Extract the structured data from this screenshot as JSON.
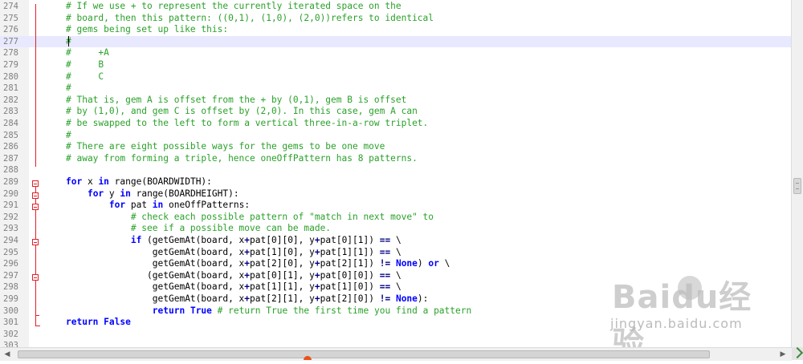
{
  "editor": {
    "current_line": 277,
    "lines": [
      {
        "n": "274",
        "indent": "",
        "parts": [
          {
            "t": "c",
            "v": "# If we use + to represent the currently iterated space on the"
          }
        ]
      },
      {
        "n": "275",
        "indent": "",
        "parts": [
          {
            "t": "c",
            "v": "# board, then this pattern: ((0,1), (1,0), (2,0))refers to identical"
          }
        ]
      },
      {
        "n": "276",
        "indent": "",
        "parts": [
          {
            "t": "c",
            "v": "# gems being set up like this:"
          }
        ]
      },
      {
        "n": "277",
        "indent": "",
        "parts": [
          {
            "t": "c",
            "v": "#"
          }
        ]
      },
      {
        "n": "278",
        "indent": "",
        "parts": [
          {
            "t": "c",
            "v": "#     +A"
          }
        ]
      },
      {
        "n": "279",
        "indent": "",
        "parts": [
          {
            "t": "c",
            "v": "#     B"
          }
        ]
      },
      {
        "n": "280",
        "indent": "",
        "parts": [
          {
            "t": "c",
            "v": "#     C"
          }
        ]
      },
      {
        "n": "281",
        "indent": "",
        "parts": [
          {
            "t": "c",
            "v": "#"
          }
        ]
      },
      {
        "n": "282",
        "indent": "",
        "parts": [
          {
            "t": "c",
            "v": "# That is, gem A is offset from the + by (0,1), gem B is offset"
          }
        ]
      },
      {
        "n": "283",
        "indent": "",
        "parts": [
          {
            "t": "c",
            "v": "# by (1,0), and gem C is offset by (2,0). In this case, gem A can"
          }
        ]
      },
      {
        "n": "284",
        "indent": "",
        "parts": [
          {
            "t": "c",
            "v": "# be swapped to the left to form a vertical three-in-a-row triplet."
          }
        ]
      },
      {
        "n": "285",
        "indent": "",
        "parts": [
          {
            "t": "c",
            "v": "#"
          }
        ]
      },
      {
        "n": "286",
        "indent": "",
        "parts": [
          {
            "t": "c",
            "v": "# There are eight possible ways for the gems to be one move"
          }
        ]
      },
      {
        "n": "287",
        "indent": "",
        "parts": [
          {
            "t": "c",
            "v": "# away from forming a triple, hence oneOffPattern has 8 patterns."
          }
        ]
      },
      {
        "n": "288",
        "indent": "",
        "parts": []
      },
      {
        "n": "289",
        "indent": "",
        "parts": [
          {
            "t": "k",
            "v": "for"
          },
          {
            "t": "nm",
            "v": " x "
          },
          {
            "t": "k",
            "v": "in"
          },
          {
            "t": "nm",
            "v": " range(BOARDWIDTH):"
          }
        ]
      },
      {
        "n": "290",
        "indent": "    ",
        "parts": [
          {
            "t": "k",
            "v": "for"
          },
          {
            "t": "nm",
            "v": " y "
          },
          {
            "t": "k",
            "v": "in"
          },
          {
            "t": "nm",
            "v": " range(BOARDHEIGHT):"
          }
        ]
      },
      {
        "n": "291",
        "indent": "        ",
        "parts": [
          {
            "t": "k",
            "v": "for"
          },
          {
            "t": "nm",
            "v": " pat "
          },
          {
            "t": "k",
            "v": "in"
          },
          {
            "t": "nm",
            "v": " oneOffPatterns:"
          }
        ]
      },
      {
        "n": "292",
        "indent": "            ",
        "parts": [
          {
            "t": "c",
            "v": "# check each possible pattern of \"match in next move\" to"
          }
        ]
      },
      {
        "n": "293",
        "indent": "            ",
        "parts": [
          {
            "t": "c",
            "v": "# see if a possible move can be made."
          }
        ]
      },
      {
        "n": "294",
        "indent": "            ",
        "parts": [
          {
            "t": "k",
            "v": "if"
          },
          {
            "t": "nm",
            "v": " (getGemAt(board, x"
          },
          {
            "t": "op",
            "v": "+"
          },
          {
            "t": "nm",
            "v": "pat[0][0], y"
          },
          {
            "t": "op",
            "v": "+"
          },
          {
            "t": "nm",
            "v": "pat[0][1]) "
          },
          {
            "t": "op",
            "v": "=="
          },
          {
            "t": "nm",
            "v": " \\"
          }
        ]
      },
      {
        "n": "295",
        "indent": "                ",
        "parts": [
          {
            "t": "nm",
            "v": "getGemAt(board, x"
          },
          {
            "t": "op",
            "v": "+"
          },
          {
            "t": "nm",
            "v": "pat[1][0], y"
          },
          {
            "t": "op",
            "v": "+"
          },
          {
            "t": "nm",
            "v": "pat[1][1]) "
          },
          {
            "t": "op",
            "v": "=="
          },
          {
            "t": "nm",
            "v": " \\"
          }
        ]
      },
      {
        "n": "296",
        "indent": "                ",
        "parts": [
          {
            "t": "nm",
            "v": "getGemAt(board, x"
          },
          {
            "t": "op",
            "v": "+"
          },
          {
            "t": "nm",
            "v": "pat[2][0], y"
          },
          {
            "t": "op",
            "v": "+"
          },
          {
            "t": "nm",
            "v": "pat[2][1]) "
          },
          {
            "t": "op",
            "v": "!="
          },
          {
            "t": "nm",
            "v": " "
          },
          {
            "t": "k",
            "v": "None"
          },
          {
            "t": "nm",
            "v": ") "
          },
          {
            "t": "k",
            "v": "or"
          },
          {
            "t": "nm",
            "v": " \\"
          }
        ]
      },
      {
        "n": "297",
        "indent": "               ",
        "parts": [
          {
            "t": "nm",
            "v": "(getGemAt(board, x"
          },
          {
            "t": "op",
            "v": "+"
          },
          {
            "t": "nm",
            "v": "pat[0][1], y"
          },
          {
            "t": "op",
            "v": "+"
          },
          {
            "t": "nm",
            "v": "pat[0][0]) "
          },
          {
            "t": "op",
            "v": "=="
          },
          {
            "t": "nm",
            "v": " \\"
          }
        ]
      },
      {
        "n": "298",
        "indent": "                ",
        "parts": [
          {
            "t": "nm",
            "v": "getGemAt(board, x"
          },
          {
            "t": "op",
            "v": "+"
          },
          {
            "t": "nm",
            "v": "pat[1][1], y"
          },
          {
            "t": "op",
            "v": "+"
          },
          {
            "t": "nm",
            "v": "pat[1][0]) "
          },
          {
            "t": "op",
            "v": "=="
          },
          {
            "t": "nm",
            "v": " \\"
          }
        ]
      },
      {
        "n": "299",
        "indent": "                ",
        "parts": [
          {
            "t": "nm",
            "v": "getGemAt(board, x"
          },
          {
            "t": "op",
            "v": "+"
          },
          {
            "t": "nm",
            "v": "pat[2][1], y"
          },
          {
            "t": "op",
            "v": "+"
          },
          {
            "t": "nm",
            "v": "pat[2][0]) "
          },
          {
            "t": "op",
            "v": "!="
          },
          {
            "t": "nm",
            "v": " "
          },
          {
            "t": "k",
            "v": "None"
          },
          {
            "t": "nm",
            "v": "):"
          }
        ]
      },
      {
        "n": "300",
        "indent": "                ",
        "parts": [
          {
            "t": "k",
            "v": "return"
          },
          {
            "t": "nm",
            "v": " "
          },
          {
            "t": "k",
            "v": "True"
          },
          {
            "t": "nm",
            "v": " "
          },
          {
            "t": "c",
            "v": "# return True the first time you find a pattern"
          }
        ]
      },
      {
        "n": "301",
        "indent": "",
        "parts": [
          {
            "t": "k",
            "v": "return"
          },
          {
            "t": "nm",
            "v": " "
          },
          {
            "t": "k",
            "v": "False"
          }
        ]
      },
      {
        "n": "302",
        "indent": "",
        "parts": []
      },
      {
        "n": "303",
        "indent": "",
        "parts": []
      }
    ]
  },
  "watermark": {
    "brand": "Baidu经验",
    "url": "jingyan.baidu.com"
  },
  "icons": {
    "fold": "fold-minus-icon",
    "scroll_left": "scroll-left-arrow-icon",
    "scroll_right": "scroll-right-arrow-icon"
  },
  "colors": {
    "comment": "#2aa12a",
    "keyword": "#0000ff",
    "operator": "#000080",
    "fold_marker": "#e0202a",
    "current_line": "#e8e8ff"
  }
}
